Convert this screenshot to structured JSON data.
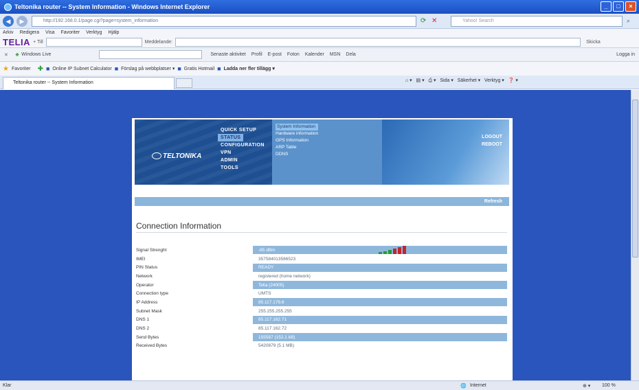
{
  "window": {
    "title": "Teltonika router -- System Information - Windows Internet Explorer"
  },
  "address": {
    "url": "http://192.168.0.1/page.cgi?page=system_information",
    "search_placeholder": "Yahoo! Search"
  },
  "menu": [
    "Arkiv",
    "Redigera",
    "Visa",
    "Favoriter",
    "Verktyg",
    "Hjälp"
  ],
  "telia": {
    "logo": "TELIA",
    "to_label": "+ Till",
    "message_label": "Meddelande:",
    "send": "Skicka"
  },
  "live": {
    "label": "Windows Live",
    "links": [
      "Senaste aktivitet",
      "Profil",
      "E-post",
      "Foton",
      "Kalender",
      "MSN",
      "Dela"
    ],
    "login": "Logga in"
  },
  "favorites": {
    "label": "Favoriter",
    "links": [
      "Online IP Subnet Calculator",
      "Förslag på webbplatser ▾",
      "Gratis Hotmail",
      "Ladda ner fler tillägg ▾"
    ]
  },
  "tab": {
    "label": "Teltonika router -- System Information"
  },
  "commandbar": {
    "items": [
      "Sida ▾",
      "Säkerhet ▾",
      "Verktyg ▾"
    ]
  },
  "router": {
    "logo": "TELTONIKA",
    "nav": [
      "QUICK SETUP",
      "STATUS",
      "CONFIGURATION",
      "VPN",
      "ADMIN",
      "TOOLS"
    ],
    "active_nav": "STATUS",
    "subnav": [
      "System Information",
      "Hardware information",
      "GPS Information",
      "ARP Table",
      "DDNS"
    ],
    "active_subnav": "System Information",
    "logout": "LOGOUT",
    "reboot": "REBOOT",
    "refresh": "Refresh",
    "section_title": "Connection Information",
    "rows": [
      {
        "label": "Signal Strenght",
        "value": "-85 dBm"
      },
      {
        "label": "IMEI",
        "value": "357584013586523"
      },
      {
        "label": "PIN Status",
        "value": "READY"
      },
      {
        "label": "Network",
        "value": "registered (home network)"
      },
      {
        "label": "Operator",
        "value": "Telia (24005)"
      },
      {
        "label": "Connection type",
        "value": "UMTS"
      },
      {
        "label": "IP Address",
        "value": "85.117.179.8"
      },
      {
        "label": "Subnet Mask",
        "value": "255.255.255.255"
      },
      {
        "label": "DNS 1",
        "value": "85.117.162.71"
      },
      {
        "label": "DNS 2",
        "value": "85.117.162.72"
      },
      {
        "label": "Send Bytes",
        "value": "155587 (152.1 kB)"
      },
      {
        "label": "Received Bytes",
        "value": "5420879 (5.1 MB)"
      }
    ],
    "signal_colors": [
      "#1f9b3a",
      "#1f9b3a",
      "#1f9b3a",
      "#c0272d",
      "#c0272d",
      "#c0272d"
    ]
  },
  "status": {
    "left": "Klar",
    "zone": "Internet",
    "zoom": "100 %"
  }
}
